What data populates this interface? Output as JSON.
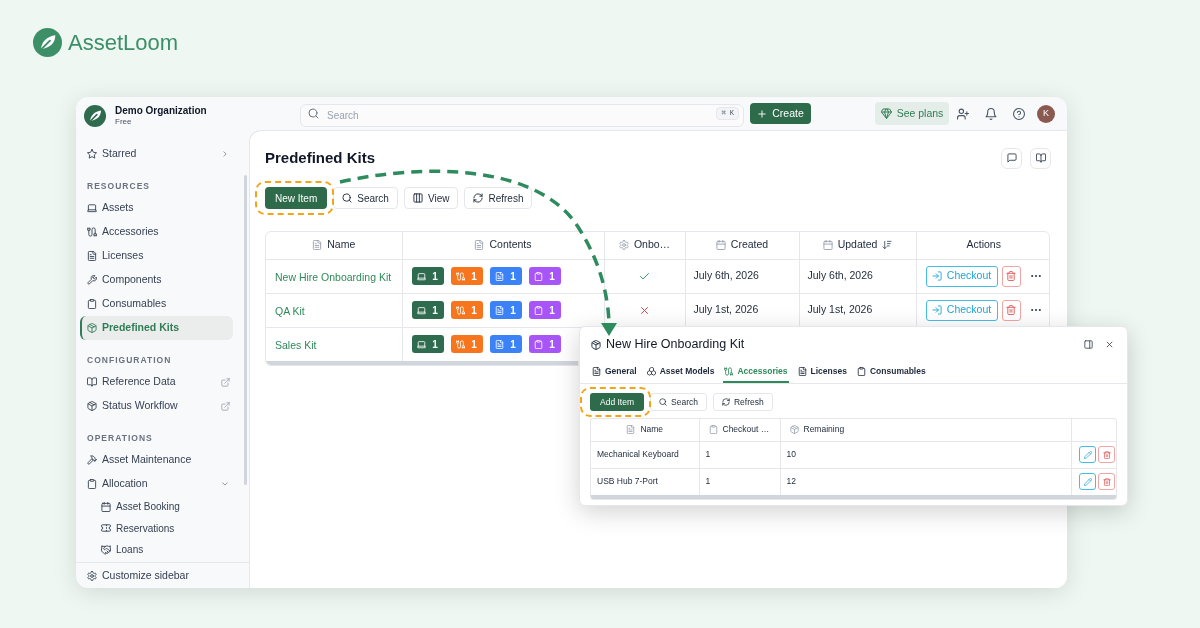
{
  "brand": {
    "name": "AssetLoom"
  },
  "organization": {
    "name": "Demo Organization",
    "plan": "Free"
  },
  "sidebar": {
    "starred": {
      "label": "Starred",
      "expanded": false
    },
    "sections": [
      {
        "title": "RESOURCES",
        "items": [
          {
            "label": "Assets",
            "selected": false
          },
          {
            "label": "Accessories",
            "selected": false
          },
          {
            "label": "Licenses",
            "selected": false
          },
          {
            "label": "Components",
            "selected": false
          },
          {
            "label": "Consumables",
            "selected": false
          },
          {
            "label": "Predefined Kits",
            "selected": true
          }
        ]
      },
      {
        "title": "CONFIGURATION",
        "items": [
          {
            "label": "Reference Data",
            "selected": false,
            "external": true
          },
          {
            "label": "Status Workflow",
            "selected": false,
            "external": true
          }
        ]
      },
      {
        "title": "OPERATIONS",
        "items": [
          {
            "label": "Asset Maintenance",
            "selected": false
          },
          {
            "label": "Allocation",
            "selected": false,
            "expanded": true,
            "children": [
              {
                "label": "Asset Booking",
                "selected": false
              },
              {
                "label": "Reservations",
                "selected": false
              },
              {
                "label": "Loans",
                "selected": false
              }
            ]
          }
        ]
      }
    ],
    "footer": {
      "label": "Customize sidebar"
    }
  },
  "topbar": {
    "search": {
      "placeholder": "Search",
      "shortcut": "⌘ K"
    },
    "create_button": "Create",
    "plans_button": "See plans",
    "avatar": "K"
  },
  "page": {
    "title": "Predefined Kits",
    "toolbar": [
      {
        "label": "New Item",
        "kind": "primary",
        "highlighted": true
      },
      {
        "label": "Search",
        "kind": "search",
        "highlighted": false
      },
      {
        "label": "View",
        "kind": "columns",
        "highlighted": false
      },
      {
        "label": "Refresh",
        "kind": "refresh",
        "highlighted": false
      }
    ],
    "table": {
      "columns": [
        {
          "label": "Name",
          "sorted": false
        },
        {
          "label": "Contents",
          "sorted": false
        },
        {
          "label": "Onbo…",
          "sorted": false
        },
        {
          "label": "Created",
          "sorted": false
        },
        {
          "label": "Updated",
          "sorted": true
        },
        {
          "label": "Actions",
          "sorted": false
        }
      ],
      "rows": [
        {
          "name": "New Hire Onboarding Kit",
          "contents": [
            {
              "kind": "assets",
              "count": "1",
              "color": "#2f6b4f"
            },
            {
              "kind": "accessories",
              "count": "1",
              "color": "#f7761d"
            },
            {
              "kind": "licenses",
              "count": "1",
              "color": "#3b82f6"
            },
            {
              "kind": "consumables",
              "count": "1",
              "color": "#a855f7"
            }
          ],
          "onboarding": true,
          "created": "July 6th, 2026",
          "updated": "July 6th, 2026",
          "action": "Checkout"
        },
        {
          "name": "QA Kit",
          "contents": [
            {
              "kind": "assets",
              "count": "1",
              "color": "#2f6b4f"
            },
            {
              "kind": "accessories",
              "count": "1",
              "color": "#f7761d"
            },
            {
              "kind": "licenses",
              "count": "1",
              "color": "#3b82f6"
            },
            {
              "kind": "consumables",
              "count": "1",
              "color": "#a855f7"
            }
          ],
          "onboarding": false,
          "created": "July 1st, 2026",
          "updated": "July 1st, 2026",
          "action": "Checkout"
        },
        {
          "name": "Sales Kit",
          "contents": [
            {
              "kind": "assets",
              "count": "1",
              "color": "#2f6b4f"
            },
            {
              "kind": "accessories",
              "count": "1",
              "color": "#f7761d"
            },
            {
              "kind": "licenses",
              "count": "1",
              "color": "#3b82f6"
            },
            {
              "kind": "consumables",
              "count": "1",
              "color": "#a855f7"
            }
          ]
        }
      ]
    }
  },
  "dialog": {
    "title": "New Hire Onboarding Kit",
    "tabs": [
      {
        "label": "General",
        "selected": false
      },
      {
        "label": "Asset Models",
        "selected": false
      },
      {
        "label": "Accessories",
        "selected": true
      },
      {
        "label": "Licenses",
        "selected": false
      },
      {
        "label": "Consumables",
        "selected": false
      }
    ],
    "toolbar": [
      {
        "label": "Add Item",
        "kind": "primary",
        "highlighted": true
      },
      {
        "label": "Search",
        "kind": "search",
        "highlighted": false
      },
      {
        "label": "Refresh",
        "kind": "refresh",
        "highlighted": false
      }
    ],
    "table": {
      "columns": [
        {
          "label": "Name"
        },
        {
          "label": "Checkout …"
        },
        {
          "label": "Remaining"
        }
      ],
      "rows": [
        {
          "name": "Mechanical Keyboard",
          "checkout": "1",
          "remaining": "10"
        },
        {
          "name": "USB Hub 7-Port",
          "checkout": "1",
          "remaining": "12"
        }
      ]
    }
  }
}
